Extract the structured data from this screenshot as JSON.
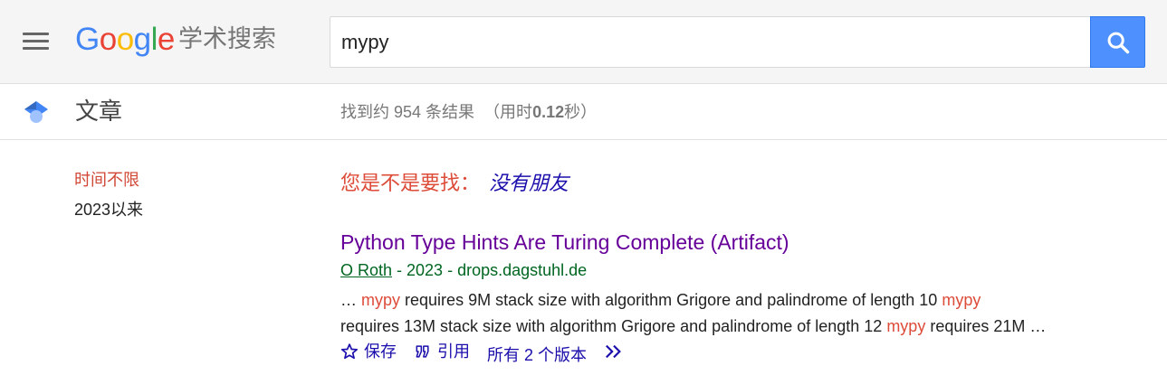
{
  "header": {
    "logo_letters": [
      "G",
      "o",
      "o",
      "g",
      "l",
      "e"
    ],
    "logo_sub": "学术搜索",
    "search_value": "mypy"
  },
  "subbar": {
    "section_title": "文章",
    "stats_prefix": "找到约 954 条结果",
    "stats_time_open": "（用时",
    "stats_time_value": "0.12",
    "stats_time_close": "秒）"
  },
  "filters": {
    "any_time": "时间不限",
    "since": "2023以来"
  },
  "did_you_mean": {
    "label": "您是不是要找：",
    "suggestion": "没有朋友"
  },
  "result": {
    "title": "Python Type Hints Are Turing Complete (Artifact)",
    "author": "O Roth",
    "meta_rest": " - 2023 - drops.dagstuhl.de",
    "snippet": [
      {
        "t": "… ",
        "h": false
      },
      {
        "t": "mypy",
        "h": true
      },
      {
        "t": " requires 9M stack size with algorithm Grigore and palindrome of length 10 ",
        "h": false
      },
      {
        "t": "mypy",
        "h": true
      },
      {
        "t": " requires 13M stack size with algorithm Grigore and palindrome of length 12 ",
        "h": false
      },
      {
        "t": "mypy",
        "h": true
      },
      {
        "t": " requires 21M …",
        "h": false
      }
    ],
    "actions": {
      "save": "保存",
      "cite": "引用",
      "versions": "所有 2 个版本"
    }
  },
  "colors": {
    "accent_blue": "#4d90fe",
    "visited_title": "#660099",
    "link": "#1a0dab",
    "meta_green": "#006621",
    "highlight_red": "#dd4b39"
  }
}
